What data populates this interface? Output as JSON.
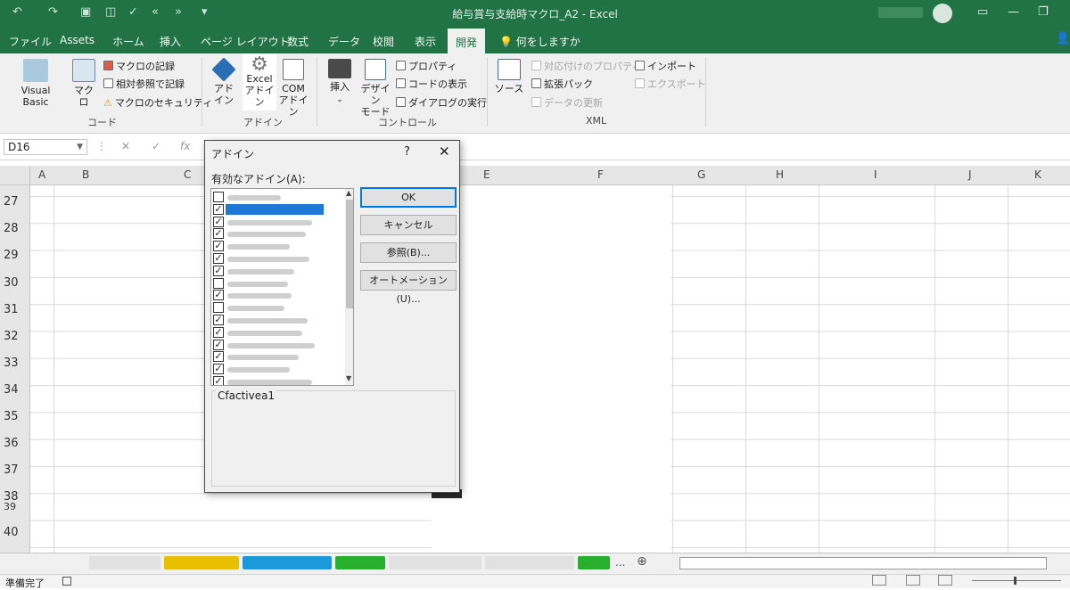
{
  "window": {
    "title": "給与賞与支給時マクロ_A2  -  Excel"
  },
  "ribbon_tabs": [
    "ファイル",
    "Assets",
    "ホーム",
    "挿入",
    "ページ レイアウト",
    "数式",
    "データ",
    "校閲",
    "表示",
    "開発"
  ],
  "active_tab": "開発",
  "tell_me": "何をしますか",
  "ribbon": {
    "visual_basic": "Visual Basic",
    "macro": "マクロ",
    "record_macro": "マクロの記録",
    "relative_ref": "相対参照で記録",
    "macro_security": "マクロのセキュリティ",
    "group_code": "コード",
    "addin_1": "アド",
    "addin_2": "イン",
    "excel_addin_1": "Excel",
    "excel_addin_2": "アドイン",
    "com_addin_1": "COM",
    "com_addin_2": "アドイン",
    "group_addin": "アドイン",
    "insert": "挿入",
    "design_mode_1": "デザイン",
    "design_mode_2": "モード",
    "properties": "プロパティ",
    "view_code": "コードの表示",
    "run_dialog": "ダイアログの実行",
    "group_controls": "コントロール",
    "source": "ソース",
    "map_properties": "対応付けのプロパティ",
    "expansion_packs": "拡張パック",
    "refresh_data": "データの更新",
    "import": "インポート",
    "export": "エクスポート",
    "group_xml": "XML"
  },
  "formula_bar": {
    "name_box": "D16",
    "fx": "fx"
  },
  "columns": [
    "A",
    "B",
    "C",
    "E",
    "F",
    "G",
    "H",
    "I",
    "J",
    "K"
  ],
  "rows": [
    "27",
    "28",
    "29",
    "30",
    "31",
    "32",
    "33",
    "34",
    "35",
    "36",
    "37",
    "38",
    "39",
    "40"
  ],
  "dialog": {
    "title": "アドイン",
    "help": "?",
    "close": "✕",
    "list_label": "有効なアドイン(A):",
    "items": [
      {
        "checked": false,
        "selected": false
      },
      {
        "checked": true,
        "selected": true
      },
      {
        "checked": true,
        "selected": false
      },
      {
        "checked": true,
        "selected": false
      },
      {
        "checked": true,
        "selected": false
      },
      {
        "checked": true,
        "selected": false
      },
      {
        "checked": true,
        "selected": false
      },
      {
        "checked": false,
        "selected": false
      },
      {
        "checked": true,
        "selected": false
      },
      {
        "checked": false,
        "selected": false
      },
      {
        "checked": true,
        "selected": false
      },
      {
        "checked": true,
        "selected": false
      },
      {
        "checked": true,
        "selected": false
      },
      {
        "checked": true,
        "selected": false
      },
      {
        "checked": true,
        "selected": false
      },
      {
        "checked": true,
        "selected": false
      }
    ],
    "buttons": {
      "ok": "OK",
      "cancel": "キャンセル",
      "browse": "参照(B)...",
      "automation": "オートメーション(U)..."
    },
    "description": "Cfactivea1"
  },
  "sheet_tabs": {
    "more": "...",
    "add": "⊕"
  },
  "status": {
    "ready": "準備完了"
  }
}
